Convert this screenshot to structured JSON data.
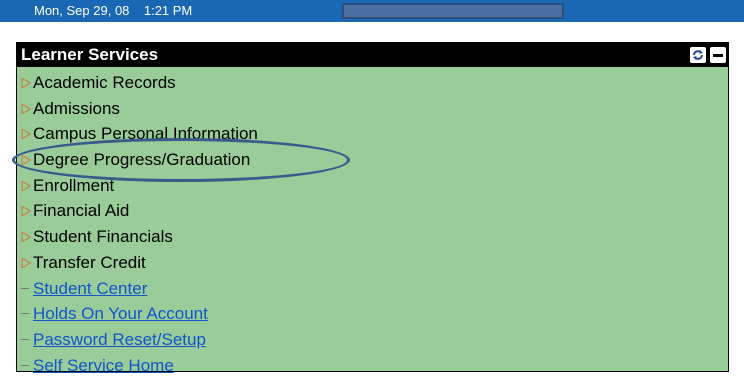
{
  "topbar": {
    "datetime": "Mon, Sep 29, 08    1:21 PM"
  },
  "panel": {
    "title": "Learner Services",
    "folders": [
      {
        "label": "Academic Records"
      },
      {
        "label": "Admissions"
      },
      {
        "label": "Campus Personal Information"
      },
      {
        "label": "Degree Progress/Graduation"
      },
      {
        "label": "Enrollment"
      },
      {
        "label": "Financial Aid"
      },
      {
        "label": "Student Financials"
      },
      {
        "label": "Transfer Credit"
      }
    ],
    "links": [
      {
        "label": "Student Center"
      },
      {
        "label": "Holds On Your Account"
      },
      {
        "label": "Password Reset/Setup"
      },
      {
        "label": "Self Service Home"
      }
    ]
  },
  "colors": {
    "topbar": "#1a67b3",
    "panel_bg": "#99cc99",
    "link": "#1155cc",
    "highlight": "#3a5a8c"
  }
}
